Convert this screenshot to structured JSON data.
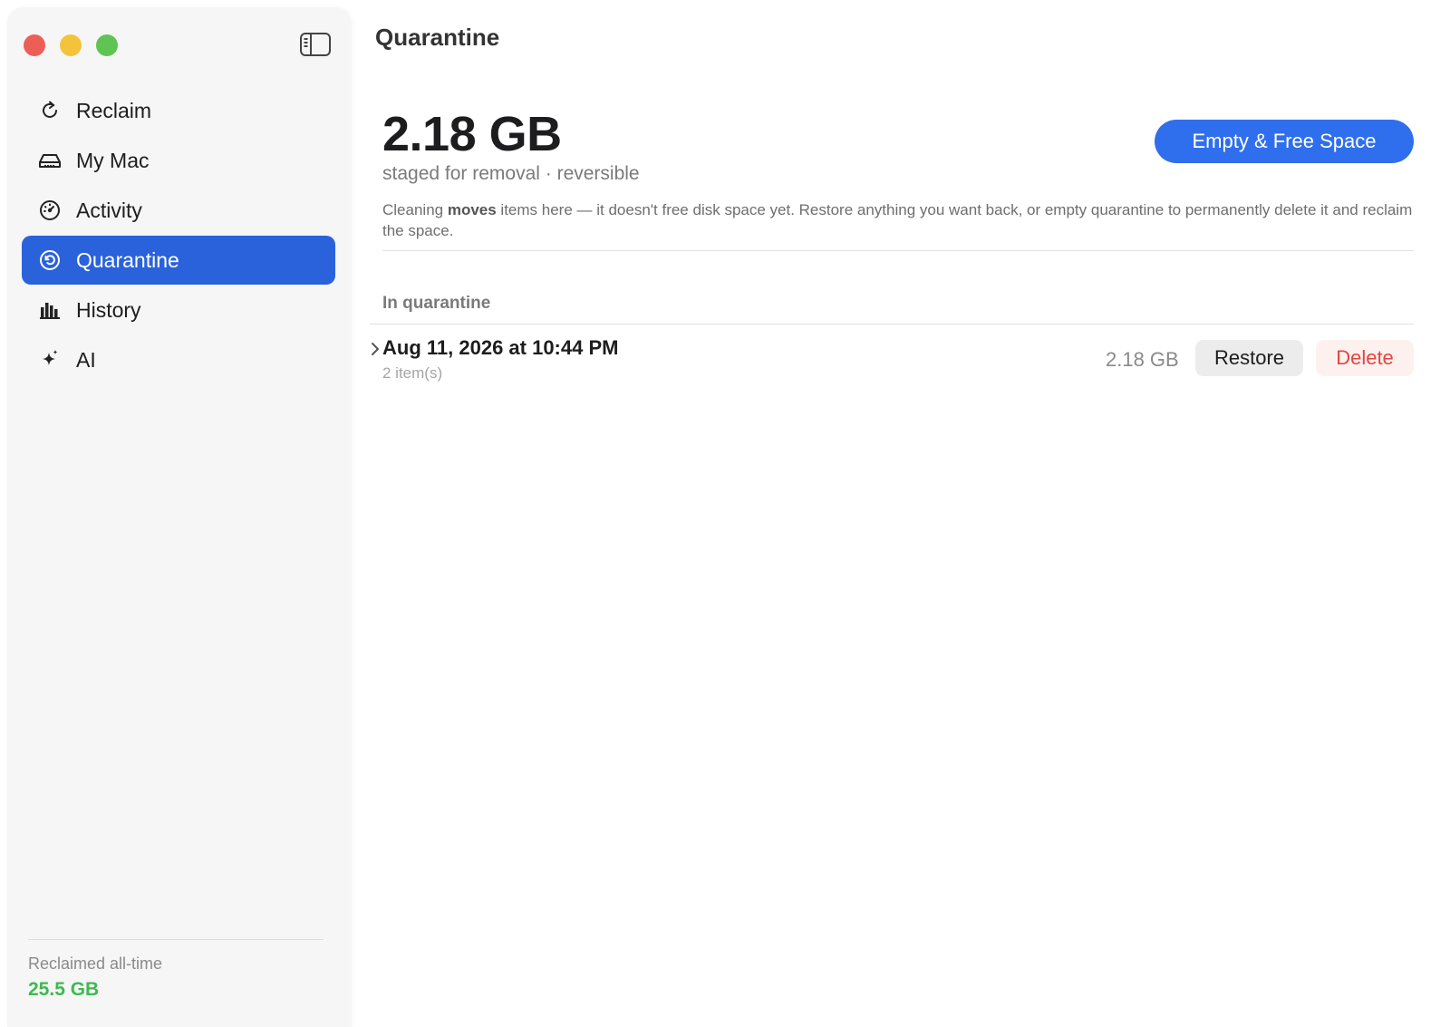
{
  "sidebar": {
    "items": [
      {
        "label": "Reclaim",
        "icon": "refresh-icon",
        "active": false
      },
      {
        "label": "My Mac",
        "icon": "drive-icon",
        "active": false
      },
      {
        "label": "Activity",
        "icon": "gauge-icon",
        "active": false
      },
      {
        "label": "Quarantine",
        "icon": "restore-clock-icon",
        "active": true
      },
      {
        "label": "History",
        "icon": "bar-chart-icon",
        "active": false
      },
      {
        "label": "AI",
        "icon": "sparkle-icon",
        "active": false
      }
    ],
    "footer": {
      "label": "Reclaimed all-time",
      "value": "25.5 GB",
      "value_color": "#3fb950"
    }
  },
  "main": {
    "title": "Quarantine",
    "summary": {
      "size": "2.18 GB",
      "subtitle": "staged for removal · reversible",
      "primary_button": "Empty & Free Space"
    },
    "description": {
      "before": "Cleaning ",
      "bold": "moves",
      "after": " items here — it doesn't free disk space yet. Restore anything you want back, or empty quarantine to permanently delete it and reclaim the space."
    },
    "section_label": "In quarantine",
    "entries": [
      {
        "title": "Aug 11, 2026 at 10:44 PM",
        "subtitle": "2 item(s)",
        "size": "2.18 GB",
        "restore_label": "Restore",
        "delete_label": "Delete"
      }
    ]
  },
  "colors": {
    "accent": "#2a62dc",
    "primary_button": "#2f6fee",
    "delete": "#e5453b",
    "traffic_red": "#ec5f57",
    "traffic_yellow": "#f5c33b",
    "traffic_green": "#5fc454"
  }
}
